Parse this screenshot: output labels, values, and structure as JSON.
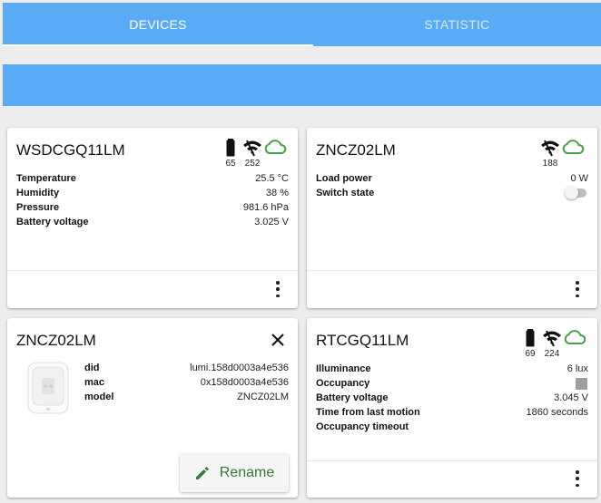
{
  "tabs": {
    "devices": "DEVICES",
    "statistic": "STATISTIC"
  },
  "colors": {
    "primary": "#5aabf5",
    "cloud": "#43a047",
    "rename": "#2e7d32",
    "background": "#ededed"
  },
  "cards": [
    {
      "title": "WSDCGQ11LM",
      "battery": "65",
      "link_quality": "252",
      "icons": [
        "battery-icon",
        "wifi-icon",
        "cloud-icon"
      ],
      "rows": [
        {
          "label": "Temperature",
          "value": "25.5 °C"
        },
        {
          "label": "Humidity",
          "value": "38 %"
        },
        {
          "label": "Pressure",
          "value": "981.6 hPa"
        },
        {
          "label": "Battery voltage",
          "value": "3.025 V"
        }
      ]
    },
    {
      "title": "ZNCZ02LM",
      "link_quality": "188",
      "icons": [
        "wifi-icon",
        "cloud-icon"
      ],
      "rows": [
        {
          "label": "Load power",
          "value": "0 W"
        },
        {
          "label": "Switch state",
          "value": ""
        }
      ],
      "switch_state": false
    },
    {
      "title": "ZNCZ02LM",
      "info": [
        {
          "label": "did",
          "value": "lumi.158d0003a4e536"
        },
        {
          "label": "mac",
          "value": "0x158d0003a4e536"
        },
        {
          "label": "model",
          "value": "ZNCZ02LM"
        }
      ],
      "rename_label": "Rename",
      "icons": [
        "close-icon",
        "pencil-icon",
        "smart-plug-image"
      ]
    },
    {
      "title": "RTCGQ11LM",
      "battery": "69",
      "link_quality": "224",
      "icons": [
        "battery-icon",
        "wifi-icon",
        "cloud-icon"
      ],
      "rows": [
        {
          "label": "Illuminance",
          "value": "6 lux"
        },
        {
          "label": "Occupancy",
          "value": ""
        },
        {
          "label": "Battery voltage",
          "value": "3.045 V"
        },
        {
          "label": "Time from last motion",
          "value": "1860 seconds"
        },
        {
          "label": "Occupancy timeout",
          "value": ""
        }
      ]
    }
  ]
}
